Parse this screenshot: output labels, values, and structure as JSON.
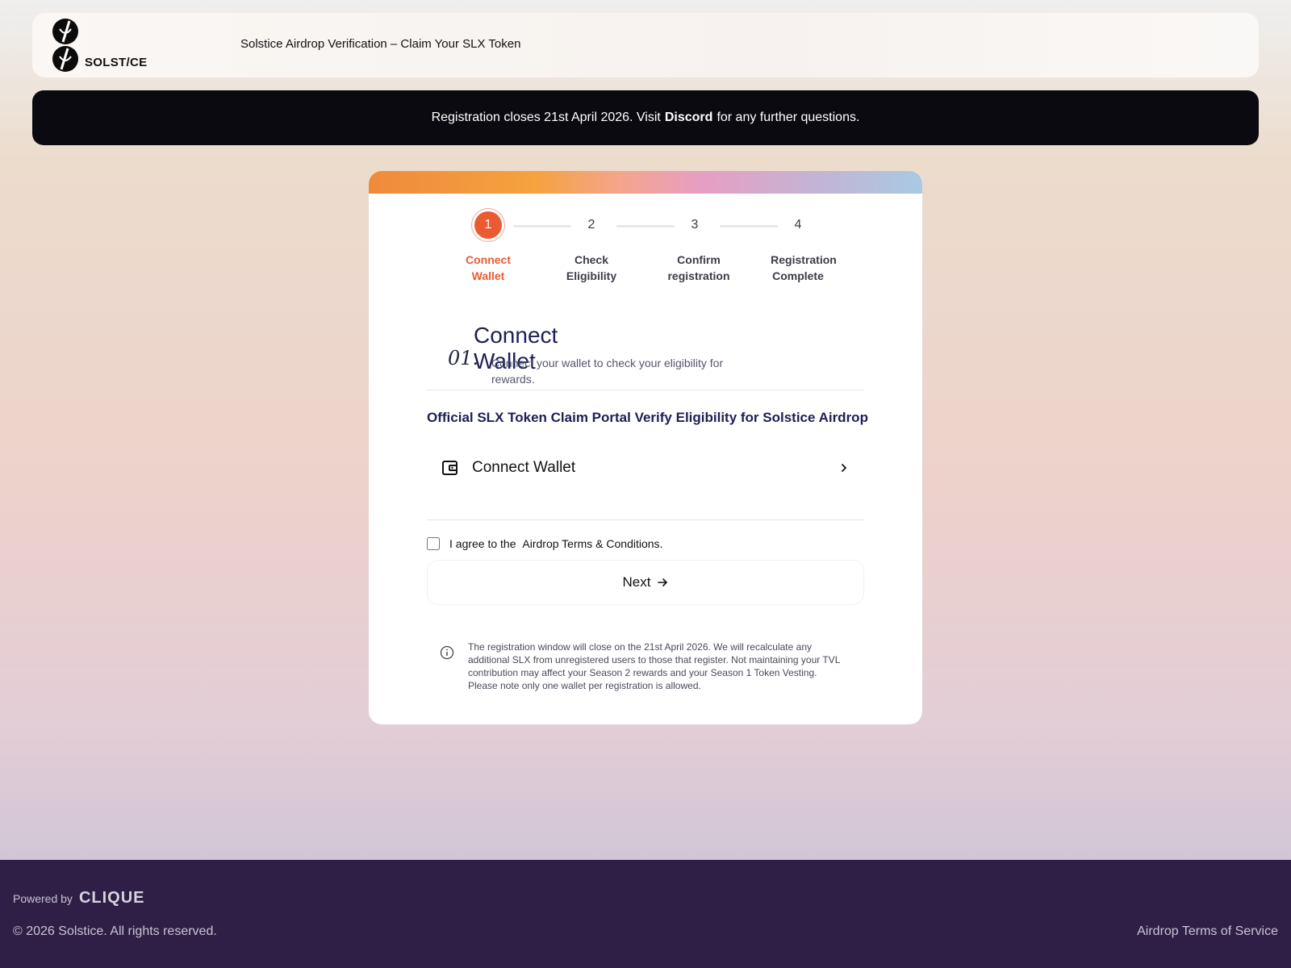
{
  "header": {
    "logo_text": "SOLST/CE",
    "title": "Solstice Airdrop Verification – Claim Your SLX Token"
  },
  "banner": {
    "text_before": "Registration closes 21st April 2026. Visit",
    "link": "Discord",
    "text_after": "for any further questions."
  },
  "stepper": {
    "steps": [
      {
        "num": "1",
        "label_line1": "Connect",
        "label_line2": "Wallet",
        "active": true
      },
      {
        "num": "2",
        "label_line1": "Check",
        "label_line2": "Eligibility",
        "active": false
      },
      {
        "num": "3",
        "label_line1": "Confirm",
        "label_line2": "registration",
        "active": false
      },
      {
        "num": "4",
        "label_line1": "Registration",
        "label_line2": "Complete",
        "active": false
      }
    ]
  },
  "section": {
    "number": "01.",
    "title_line1": "Connect",
    "title_line2": "Wallet",
    "description": "Connect your wallet to check your eligibility for rewards."
  },
  "portal_title": "Official SLX Token Claim Portal Verify Eligibility for Solstice Airdrop",
  "connect_wallet": {
    "label": "Connect Wallet",
    "icon": "wallet-icon"
  },
  "agree": {
    "text_before": "I agree to the",
    "link": "Airdrop Terms & Conditions."
  },
  "next_button": {
    "label": "Next"
  },
  "info_text": "The registration window will close on the 21st April 2026. We will recalculate any additional SLX from unregistered users to those that register. Not maintaining your TVL contribution may affect your Season 2 rewards and your Season 1 Token Vesting. Please note only one wallet per registration is allowed.",
  "footer": {
    "powered_by": "Powered by",
    "powered_brand": "CLIQUE",
    "copyright": "© 2026 Solstice. All rights reserved.",
    "terms_link": "Airdrop Terms of Service"
  },
  "colors": {
    "accent": "#ea5b32",
    "navy": "#1d1f55",
    "banner_bg": "#0b0a10",
    "footer_bg": "#2f1f47"
  }
}
